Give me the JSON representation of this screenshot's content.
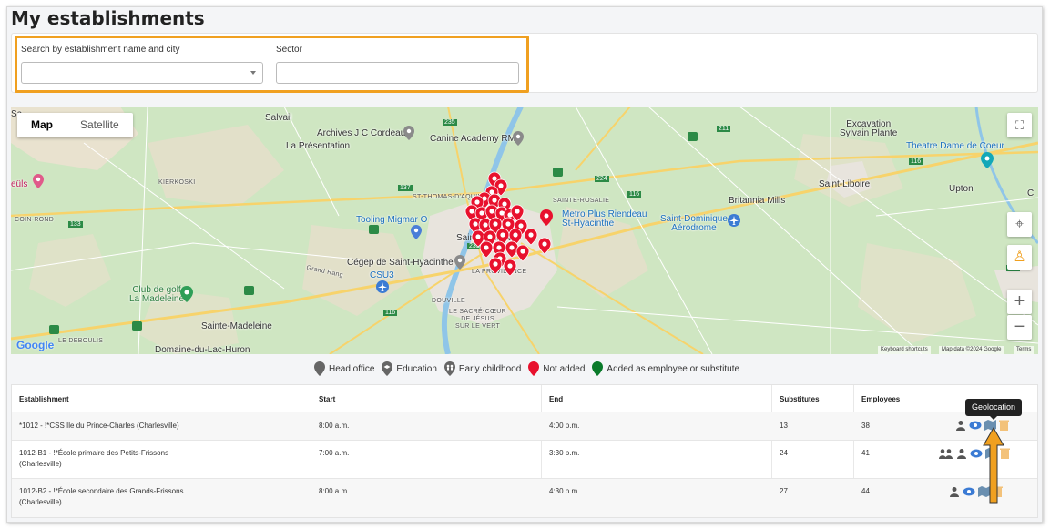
{
  "page": {
    "title": "My establishments"
  },
  "filters": {
    "search_label": "Search by establishment name and city",
    "search_value": "",
    "sector_label": "Sector",
    "sector_value": ""
  },
  "map": {
    "type_controls": {
      "map": "Map",
      "satellite": "Satellite",
      "active": "Map"
    },
    "place_labels": {
      "salvail": "Salvail",
      "la_presentation": "La Présentation",
      "archives": "Archives J C Cordeau",
      "canine": "Canine Academy RM",
      "excavation": "Excavation\nSylvain Plante",
      "theatre": "Theatre Dame de Coeur",
      "st_thomas": "ST-THOMAS-D'AQUIN",
      "kierkoski": "KIERKOSKI",
      "coin_rond": "COIN-ROND",
      "seuls": "eüls",
      "sainte_rosalie": "SAINTE-ROSALIE",
      "metro_plus": "Metro Plus Riendeau\nSt-Hyacinthe",
      "britannia": "Britannia Mills",
      "saint_liboire": "Saint-Liboire",
      "upton": "Upton",
      "tooling": "Tooling Migmar O",
      "saint_dominique": "Saint-Dominique\nAérodrome",
      "saint_hyacinthe": "Saint-Hyacinthe",
      "cegep": "Cégep de Saint-Hyacinthe",
      "grand_rang": "Grand Rang",
      "csu3": "CSU3",
      "club_golf": "Club de golf\nLa Madeleine",
      "douville": "DOUVILLE",
      "la_providence": "LA PROVIDENCE",
      "le_sacre": "LE SACRÉ-CŒUR\nDE JÉSUS\nSUR LE VERT",
      "sainte_madeleine": "Sainte-Madeleine",
      "le_debouls": "LE DEBOULIS",
      "domaine": "Domaine-du-Lac-Huron",
      "sa": "Sa",
      "c": "C"
    },
    "route_numbers": {
      "r235": "235",
      "r137": "137",
      "r224": "224",
      "r116a": "116",
      "r211": "211",
      "r116b": "116",
      "r133": "133",
      "r116c": "116",
      "r235b": "235",
      "r116d": "116"
    },
    "attribution": {
      "logo": "Google",
      "shortcuts": "Keyboard shortcuts",
      "mapdata": "Map data ©2024 Google",
      "terms": "Terms"
    },
    "pin_count": 31,
    "colors": {
      "pin_red": "#e8112d",
      "pin_green": "#0a7a2a",
      "pin_gray": "#666666",
      "water": "#8fc5e8",
      "land": "#cfe6c2",
      "urban": "#e8e4dd",
      "road_major": "#f7d36b"
    }
  },
  "legend": [
    {
      "label": "Head office",
      "icon": "map-pin-gray-icon",
      "color": "#666666"
    },
    {
      "label": "Education",
      "icon": "map-pin-education-icon",
      "color": "#666666"
    },
    {
      "label": "Early childhood",
      "icon": "map-pin-early-childhood-icon",
      "color": "#666666"
    },
    {
      "label": "Not added",
      "icon": "map-pin-red-icon",
      "color": "#e8112d"
    },
    {
      "label": "Added as employee or substitute",
      "icon": "map-pin-green-icon",
      "color": "#0a7a2a"
    }
  ],
  "table": {
    "headers": {
      "establishment": "Establishment",
      "start": "Start",
      "end": "End",
      "substitutes": "Substitutes",
      "employees": "Employees"
    },
    "rows": [
      {
        "establishment": "*1012 - !*CSS Ile du Prince-Charles (Charlesville)",
        "start": "8:00 a.m.",
        "end": "4:00 p.m.",
        "substitutes": "13",
        "employees": "38"
      },
      {
        "establishment": "1012-B1 - !*École primaire des Petits-Frissons\n(Charlesville)",
        "start": "7:00 a.m.",
        "end": "3:30 p.m.",
        "substitutes": "24",
        "employees": "41"
      },
      {
        "establishment": "1012-B2 - !*École secondaire des Grands-Frissons\n(Charlesville)",
        "start": "8:00 a.m.",
        "end": "4:30 p.m.",
        "substitutes": "27",
        "employees": "44"
      }
    ]
  },
  "tooltip": {
    "label": "Geolocation"
  },
  "annotation": {
    "highlight_color": "#f0a020",
    "arrow_color": "#f0a020"
  }
}
